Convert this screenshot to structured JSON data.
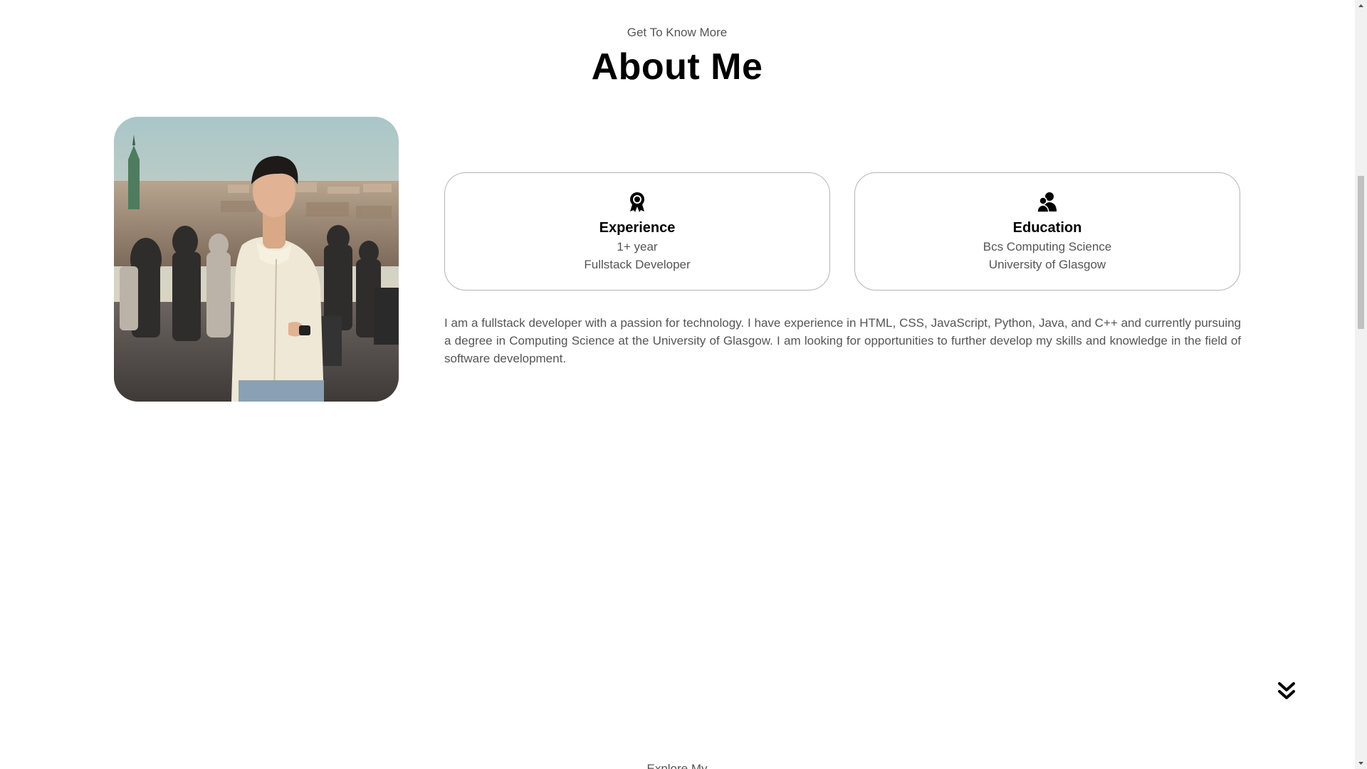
{
  "header": {
    "subtitle": "Get To Know More",
    "title": "About Me"
  },
  "profile_photo": {
    "alt": "Profile picture",
    "icon": "person-photo"
  },
  "cards": {
    "experience": {
      "icon": "award-icon",
      "heading": "Experience",
      "line1": "1+ year",
      "line2": "Fullstack Developer"
    },
    "education": {
      "icon": "education-icon",
      "heading": "Education",
      "line1": "Bcs Computing Science",
      "line2": "University of Glasgow"
    }
  },
  "bio": "I am a fullstack developer with a passion for technology. I have experience in HTML, CSS, JavaScript, Python, Java, and C++ and currently pursuing a degree in Computing Science at the University of Glasgow. I am looking for opportunities to further develop my skills and knowledge in the field of software development.",
  "scroll_arrow": {
    "icon": "double-chevron-down-icon"
  },
  "next_section": {
    "subtitle": "Explore My"
  },
  "colors": {
    "text_primary": "#000000",
    "text_secondary": "#555555",
    "border": "#b5b5b5",
    "background": "#ffffff"
  }
}
